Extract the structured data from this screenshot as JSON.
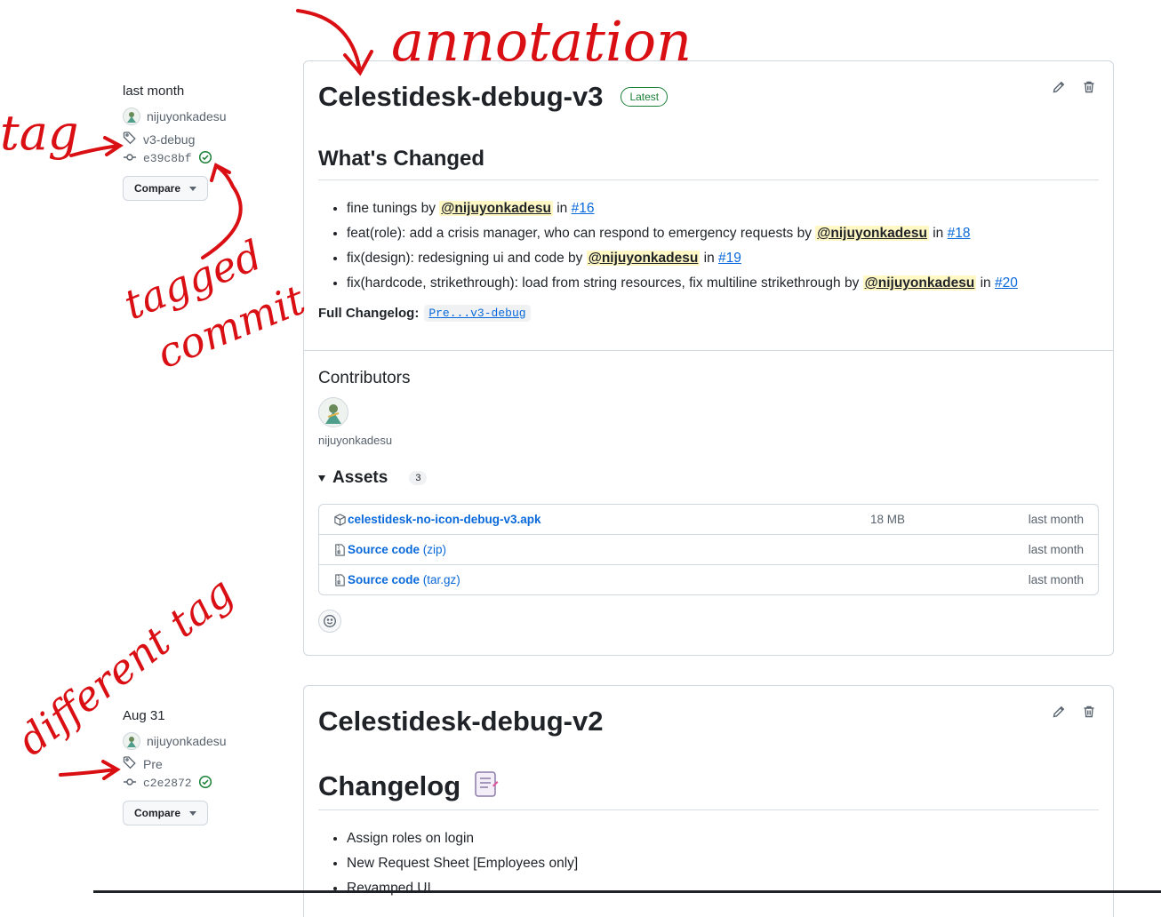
{
  "release1": {
    "meta": {
      "date": "last month",
      "author": "nijuyonkadesu",
      "tag": "v3-debug",
      "commit": "e39c8bf",
      "compare_label": "Compare"
    },
    "title": "Celestidesk-debug-v3",
    "latest_label": "Latest",
    "whats_changed": "What's Changed",
    "changes": [
      {
        "text": "fine tunings by",
        "mention": "@nijuyonkadesu",
        "in": "in",
        "issue": "#16"
      },
      {
        "text": "feat(role): add a crisis manager, who can respond to emergency requests by",
        "mention": "@nijuyonkadesu",
        "in": "in",
        "issue": "#18"
      },
      {
        "text": "fix(design): redesigning ui and code by",
        "mention": "@nijuyonkadesu",
        "in": "in",
        "issue": "#19"
      },
      {
        "text": "fix(hardcode, strikethrough): load from string resources, fix multiline strikethrough by",
        "mention": "@nijuyonkadesu",
        "in": "in",
        "issue": "#20"
      }
    ],
    "full_changelog_label": "Full Changelog:",
    "full_changelog_link": "Pre...v3-debug",
    "contributors_label": "Contributors",
    "contributor": "nijuyonkadesu",
    "assets_label": "Assets",
    "assets_count": "3",
    "assets": [
      {
        "name": "celestidesk-no-icon-debug-v3.apk",
        "ext": "",
        "size": "18 MB",
        "when": "last month",
        "icon": "package-icon"
      },
      {
        "name": "Source code",
        "ext": " (zip)",
        "size": "",
        "when": "last month",
        "icon": "file-zip-icon"
      },
      {
        "name": "Source code",
        "ext": " (tar.gz)",
        "size": "",
        "when": "last month",
        "icon": "file-zip-icon"
      }
    ]
  },
  "release2": {
    "meta": {
      "date": "Aug 31",
      "author": "nijuyonkadesu",
      "tag": "Pre",
      "commit": "c2e2872",
      "compare_label": "Compare"
    },
    "title": "Celestidesk-debug-v2",
    "changelog_heading": "Changelog",
    "changes": [
      "Assign roles on login",
      "New Request Sheet [Employees only]",
      "Revamped UI"
    ]
  },
  "annotations": {
    "annotation": "annotation",
    "tag": "tag",
    "tagged": "tagged",
    "commit": "commit",
    "different_tag": "different tag"
  },
  "colors": {
    "link": "#0969da",
    "latest_green": "#1a7f37",
    "mention_bg": "#fff8c5",
    "annotation_red": "#d90f14"
  }
}
